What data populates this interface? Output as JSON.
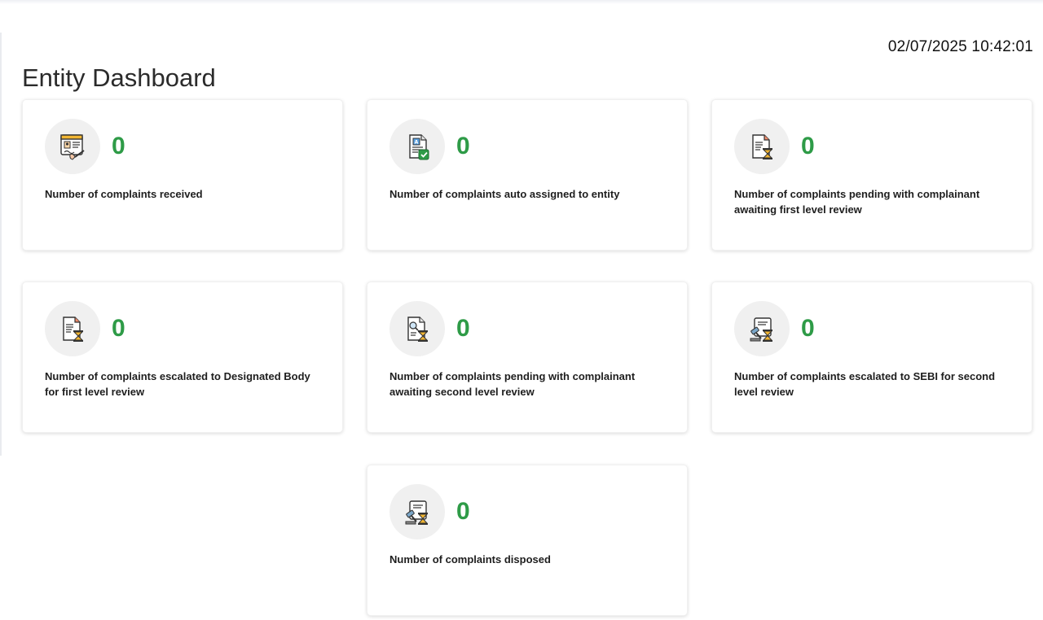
{
  "header": {
    "timestamp": "02/07/2025 10:42:01",
    "title": "Entity Dashboard"
  },
  "colors": {
    "count": "#2e9b47",
    "icon_circle": "#f0f0f0"
  },
  "cards": [
    {
      "count": "0",
      "label": "Number of complaints received",
      "icon": "document-signature-icon"
    },
    {
      "count": "0",
      "label": "Number of complaints auto assigned to entity",
      "icon": "document-check-icon"
    },
    {
      "count": "0",
      "label": "Number of complaints pending with complainant awaiting first level review",
      "icon": "document-hourglass-icon"
    },
    {
      "count": "0",
      "label": "Number of complaints escalated to Designated Body for first level review",
      "icon": "document-hourglass-icon"
    },
    {
      "count": "0",
      "label": "Number of complaints pending with complainant awaiting second level review",
      "icon": "document-search-hourglass-icon"
    },
    {
      "count": "0",
      "label": "Number of complaints escalated to SEBI for second level review",
      "icon": "gavel-hourglass-icon"
    },
    {
      "count": "0",
      "label": "Number of complaints disposed",
      "icon": "gavel-hourglass-icon"
    }
  ]
}
